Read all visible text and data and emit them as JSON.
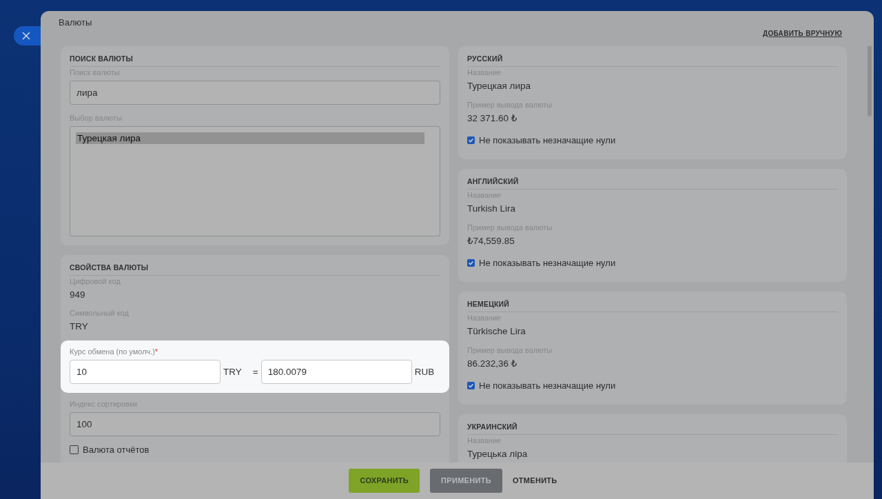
{
  "dialog": {
    "title": "Валюты",
    "add_link": "ДОБАВИТЬ ВРУЧНУЮ"
  },
  "search_section": {
    "heading": "ПОИСК ВАЛЮТЫ",
    "search_label": "Поиск валюты",
    "search_value": "лира",
    "select_label": "Выбор валюты",
    "options": [
      {
        "label": "Турецкая лира",
        "selected": true
      }
    ]
  },
  "properties_section": {
    "heading": "СВОЙСТВА ВАЛЮТЫ",
    "fields": [
      {
        "kind": "static",
        "label": "Цифровой код",
        "value": "949"
      },
      {
        "kind": "static",
        "label": "Символьный код",
        "value": "TRY"
      },
      {
        "kind": "rate",
        "label": "Курс обмена (по умолч.)",
        "required_mark": "*",
        "amount": "10",
        "from_code": "TRY",
        "equals": "=",
        "rate": "180.0079",
        "to_code": "RUB"
      },
      {
        "kind": "input",
        "label": "Индекс сортировки",
        "value": "100"
      },
      {
        "kind": "checkbox",
        "label": "Валюта отчётов",
        "checked": false
      }
    ]
  },
  "languages": [
    {
      "heading": "РУССКИЙ",
      "name_label": "Название",
      "name": "Турецкая лира",
      "example_label": "Пример вывода валюты",
      "example": "32 371.60 ₺",
      "hide_zeros_label": "Не показывать незначащие нули",
      "hide_zeros": true
    },
    {
      "heading": "АНГЛИЙСКИЙ",
      "name_label": "Название",
      "name": "Turkish Lira",
      "example_label": "Пример вывода валюты",
      "example": "₺74,559.85",
      "hide_zeros_label": "Не показывать незначащие нули",
      "hide_zeros": true
    },
    {
      "heading": "НЕМЕЦКИЙ",
      "name_label": "Название",
      "name": "Türkische Lira",
      "example_label": "Пример вывода валюты",
      "example": "86.232,36 ₺",
      "hide_zeros_label": "Не показывать незначащие нули",
      "hide_zeros": true
    },
    {
      "heading": "УКРАИНСКИЙ",
      "name_label": "Название",
      "name": "Турецька ліра"
    }
  ],
  "buttons": [
    {
      "label": "СОХРАНИТЬ",
      "kind": "primary"
    },
    {
      "label": "ПРИМЕНИТЬ",
      "kind": "secondary"
    },
    {
      "label": "ОТМЕНИТЬ",
      "kind": "link"
    }
  ]
}
